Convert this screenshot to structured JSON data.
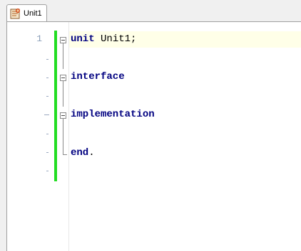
{
  "tab": {
    "label": "Unit1",
    "icon": "delphi-unit-icon"
  },
  "editor": {
    "line_numbers": [
      "1"
    ],
    "code": {
      "line1_kw": "unit",
      "line1_rest": " Unit1;",
      "line3_kw": "interface",
      "line5_kw": "implementation",
      "line7_kw": "end",
      "line7_rest": "."
    }
  },
  "colors": {
    "change_bar": "#22dd22",
    "keyword": "#000080",
    "active_line": "#ffffe8"
  }
}
